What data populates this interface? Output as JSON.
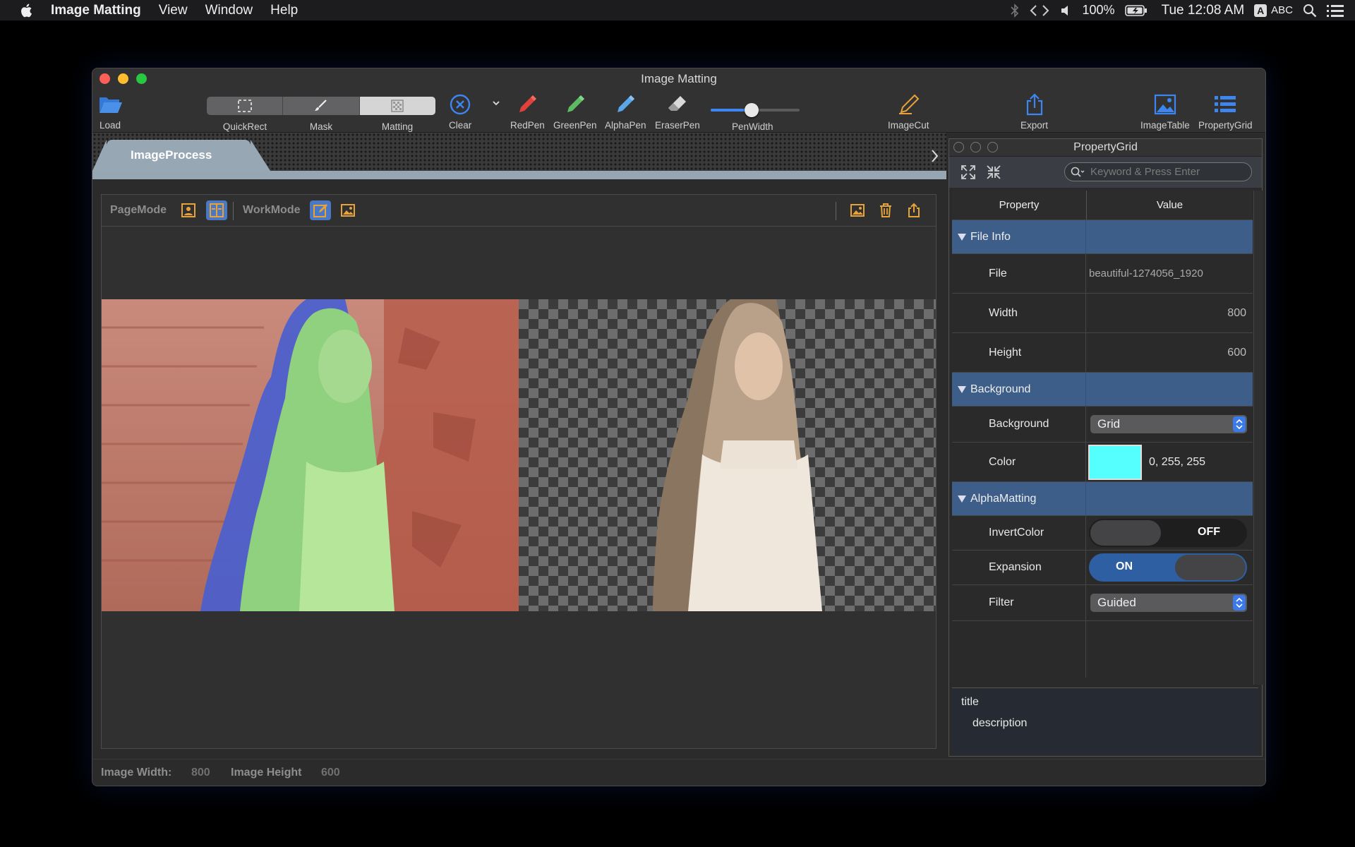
{
  "menubar": {
    "app_name": "Image Matting",
    "items": [
      "View",
      "Window",
      "Help"
    ],
    "battery": "100%",
    "clock": "Tue 12:08 AM",
    "input_source": "ABC",
    "icons": [
      "apple-icon",
      "bluetooth-icon",
      "code-icon",
      "volume-icon",
      "battery-icon",
      "input-source-icon",
      "spotlight-search-icon",
      "notification-list-icon"
    ]
  },
  "window": {
    "title": "Image Matting",
    "toolbar": {
      "load": "Load",
      "quickrect": "QuickRect",
      "mask": "Mask",
      "matting": "Matting",
      "clear": "Clear",
      "redpen": "RedPen",
      "greenpen": "GreenPen",
      "alphapen": "AlphaPen",
      "eraserpen": "EraserPen",
      "penwidth": "PenWidth",
      "penwidth_value": 0.45,
      "imagecut": "ImageCut",
      "export": "Export",
      "imagetable": "ImageTable",
      "propertygrid": "PropertyGrid"
    },
    "tab": "ImageProcess",
    "panel": {
      "pagemode": "PageMode",
      "workmode": "WorkMode"
    },
    "status": {
      "width_label": "Image Width:",
      "width_value": "800",
      "height_label": "Image Height",
      "height_value": "600"
    }
  },
  "propertygrid": {
    "title": "PropertyGrid",
    "search_placeholder": "Keyword & Press Enter",
    "col_property": "Property",
    "col_value": "Value",
    "file_info": {
      "category": "File Info",
      "file_label": "File",
      "file_value": "beautiful-1274056_1920",
      "width_label": "Width",
      "width_value": "800",
      "height_label": "Height",
      "height_value": "600"
    },
    "background": {
      "category": "Background",
      "background_label": "Background",
      "background_value": "Grid",
      "color_label": "Color",
      "color_value": "0, 255, 255",
      "color_hex": "#55fffd"
    },
    "alphamatting": {
      "category": "AlphaMatting",
      "invert_label": "InvertColor",
      "invert_value": "OFF",
      "expansion_label": "Expansion",
      "expansion_value": "ON",
      "filter_label": "Filter",
      "filter_value": "Guided"
    },
    "desc_title": "title",
    "desc_body": "description"
  },
  "colors": {
    "accent": "#3d86f0",
    "category_row": "#3e5e8a",
    "red_pen": "#e0413a",
    "green_pen": "#5dbb63",
    "alpha_pen": "#5aa6e8",
    "icon_orange": "#e8a23a"
  }
}
